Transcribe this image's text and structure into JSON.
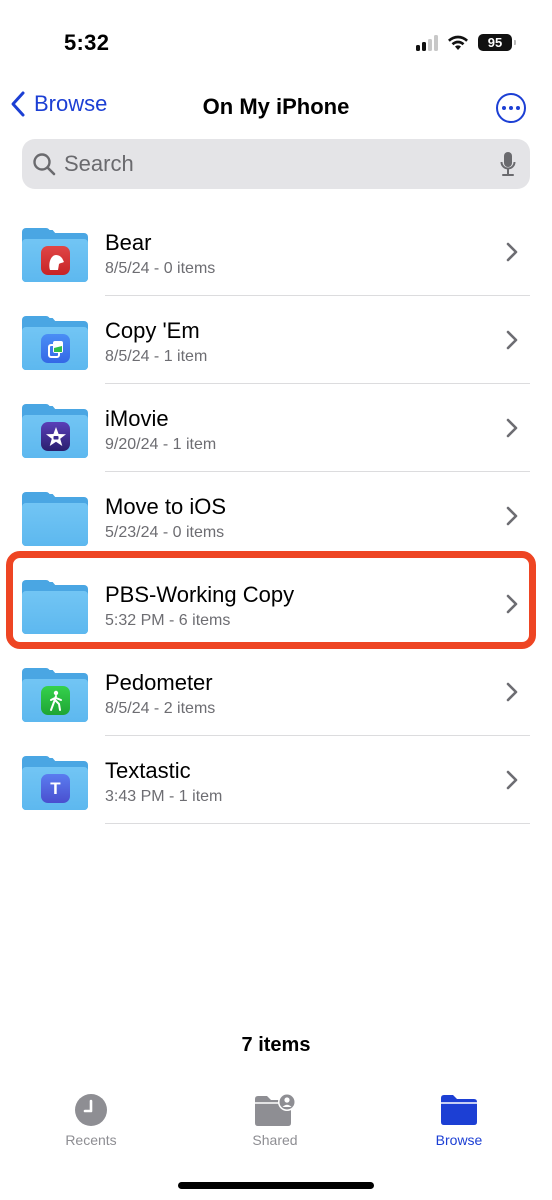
{
  "status_bar": {
    "time": "5:32",
    "battery": "95",
    "signal_bars_active": 2,
    "signal_bars_total": 4
  },
  "nav": {
    "back_label": "Browse",
    "title": "On My iPhone",
    "more_icon": "ellipsis-circle-icon"
  },
  "search": {
    "placeholder": "Search",
    "value": ""
  },
  "colors": {
    "accent": "#1c3fd4",
    "highlight": "#ee4523",
    "folder": "#5db8ef"
  },
  "files": [
    {
      "name": "Bear",
      "meta": "8/5/24 - 0 items",
      "badge": "bear-app-icon",
      "badge_color": "#d3302f"
    },
    {
      "name": "Copy 'Em",
      "meta": "8/5/24 - 1 item",
      "badge": "copyem-app-icon",
      "badge_color": "#3d7cf0"
    },
    {
      "name": "iMovie",
      "meta": "9/20/24 - 1 item",
      "badge": "imovie-app-icon",
      "badge_color": "#3b2a8f"
    },
    {
      "name": "Move to iOS",
      "meta": "5/23/24 - 0 items",
      "badge": "",
      "badge_color": ""
    },
    {
      "name": "PBS-Working Copy",
      "meta": "5:32 PM - 6 items",
      "badge": "",
      "badge_color": "",
      "highlighted": true
    },
    {
      "name": "Pedometer",
      "meta": "8/5/24 - 2 items",
      "badge": "pedometer-app-icon",
      "badge_color": "#27b83a"
    },
    {
      "name": "Textastic",
      "meta": "3:43 PM - 1 item",
      "badge": "textastic-app-icon",
      "badge_color": "#4f63dd"
    }
  ],
  "footer": {
    "item_count": "7 items"
  },
  "tabs": [
    {
      "label": "Recents",
      "icon": "clock-icon",
      "active": false
    },
    {
      "label": "Shared",
      "icon": "shared-folder-icon",
      "active": false
    },
    {
      "label": "Browse",
      "icon": "folder-icon",
      "active": true
    }
  ]
}
